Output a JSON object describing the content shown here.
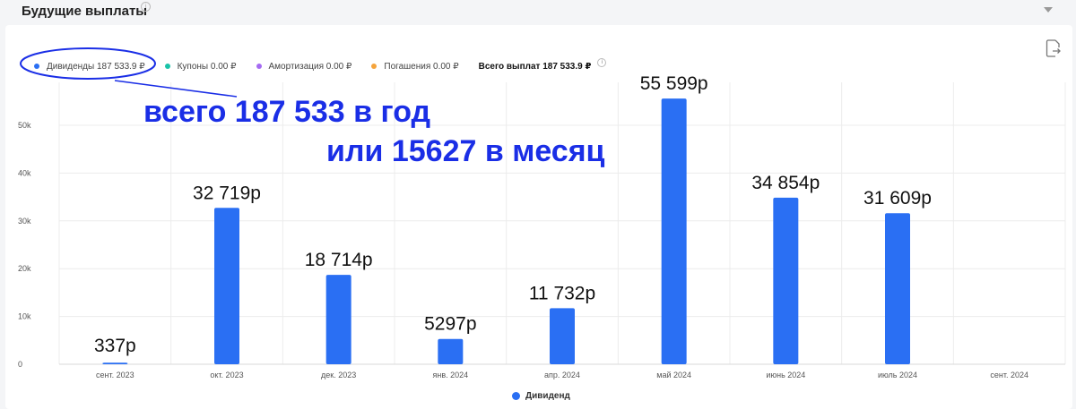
{
  "header": {
    "title": "Будущие выплаты",
    "info_icon": "info-icon",
    "collapse_icon": "chevron-down-icon"
  },
  "legend": {
    "items": [
      {
        "label": "Дивиденды 187 533.9 ₽",
        "color": "#2a6ff3"
      },
      {
        "label": "Купоны 0.00 ₽",
        "color": "#19c3a8"
      },
      {
        "label": "Амортизация 0.00 ₽",
        "color": "#a56bf2"
      },
      {
        "label": "Погашения 0.00 ₽",
        "color": "#f5a43c"
      }
    ],
    "total": "Всего выплат 187 533.9 ₽"
  },
  "toolbar": {
    "export_icon": "export-file-icon"
  },
  "annotations": {
    "line1": "всего 187 533 в год",
    "line2": "или 15627 в месяц",
    "ellipse_color": "#1a2ee6"
  },
  "bottom_legend": {
    "label": "Дивиденд",
    "color": "#2a6ff3"
  },
  "chart_data": {
    "type": "bar",
    "categories": [
      "сент. 2023",
      "окт. 2023",
      "дек. 2023",
      "янв. 2024",
      "апр. 2024",
      "май 2024",
      "июнь 2024",
      "июль 2024",
      "сент. 2024"
    ],
    "series": [
      {
        "name": "Дивиденд",
        "values": [
          337,
          32719,
          18714,
          5297,
          11732,
          55599,
          34854,
          31609,
          0
        ],
        "color": "#2a6ff3"
      }
    ],
    "bar_labels": [
      "337р",
      "32 719р",
      "18 714р",
      "5297р",
      "11 732р",
      "55 599р",
      "34 854р",
      "31 609р",
      ""
    ],
    "y_ticks": [
      0,
      10000,
      20000,
      30000,
      40000,
      50000
    ],
    "y_tick_labels": [
      "0",
      "10k",
      "20k",
      "30k",
      "40k",
      "50k"
    ],
    "ylim": [
      0,
      60000
    ],
    "grid": true,
    "legend_position": "top-left"
  }
}
